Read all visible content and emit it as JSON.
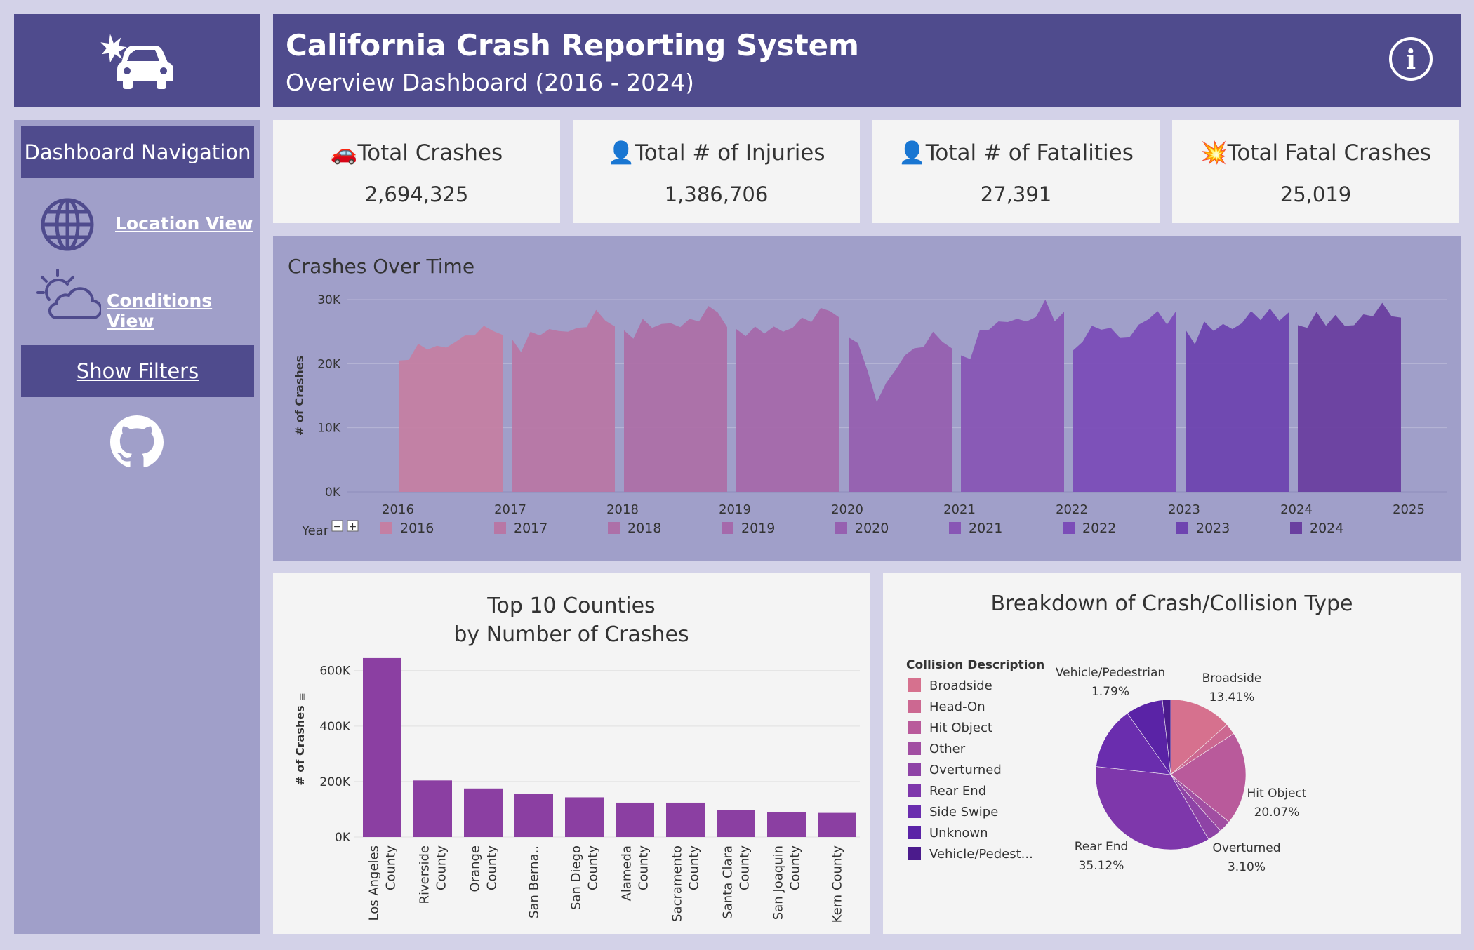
{
  "header": {
    "title": "California Crash Reporting System",
    "subtitle": "Overview Dashboard (2016 - 2024)",
    "info_symbol": "i",
    "logo_icon": "car-crash-icon",
    "accent_color": "#4f4b8d"
  },
  "sidebar": {
    "nav_title": "Dashboard Navigation",
    "links": [
      {
        "label": "Location View",
        "icon": "globe-icon"
      },
      {
        "label": "Conditions View",
        "icon": "weather-icon"
      }
    ],
    "filters_label": "Show Filters",
    "github_icon": "github-icon"
  },
  "kpis": [
    {
      "icon": "🚗",
      "label": "Total Crashes",
      "value": "2,694,325"
    },
    {
      "icon": "👤",
      "label": "Total # of Injuries",
      "value": "1,386,706"
    },
    {
      "icon": "👤",
      "label": "Total # of Fatalities",
      "value": "27,391"
    },
    {
      "icon": "💥",
      "label": "Total Fatal Crashes",
      "value": "25,019"
    }
  ],
  "chart_data": [
    {
      "type": "area",
      "title": "Crashes Over Time",
      "ylabel": "# of Crashes",
      "ylim": [
        0,
        30000
      ],
      "y_ticks": [
        "0K",
        "10K",
        "20K",
        "30K"
      ],
      "x_ticks": [
        "2016",
        "2017",
        "2018",
        "2019",
        "2020",
        "2021",
        "2022",
        "2023",
        "2024",
        "2025"
      ],
      "legend_title": "Year",
      "legend_position": "bottom",
      "grid": true,
      "series": [
        {
          "name": "2016",
          "color": "#c47fa3",
          "values": [
            20500,
            20600,
            23100,
            22200,
            22800,
            22500,
            23400,
            24400,
            24400,
            25900,
            25100,
            24500
          ]
        },
        {
          "name": "2017",
          "color": "#b877a5",
          "values": [
            23900,
            21800,
            25000,
            24400,
            25400,
            25100,
            25000,
            25600,
            25700,
            28400,
            26700,
            25800
          ]
        },
        {
          "name": "2018",
          "color": "#ad70a8",
          "values": [
            25200,
            23900,
            27000,
            25600,
            26200,
            26300,
            25700,
            27000,
            26600,
            29000,
            28000,
            25700
          ]
        },
        {
          "name": "2019",
          "color": "#a569ab",
          "values": [
            25400,
            24300,
            25800,
            24700,
            25800,
            25000,
            25600,
            27200,
            26500,
            28700,
            28200,
            27200
          ]
        },
        {
          "name": "2020",
          "color": "#9660b0",
          "values": [
            24100,
            23200,
            19000,
            14000,
            17000,
            19000,
            21300,
            22400,
            22600,
            25000,
            23400,
            22400
          ]
        },
        {
          "name": "2021",
          "color": "#8856b5",
          "values": [
            21300,
            20700,
            25200,
            25300,
            26600,
            26500,
            27000,
            26600,
            27300,
            30000,
            26600,
            28100
          ]
        },
        {
          "name": "2022",
          "color": "#7b4db8",
          "values": [
            22100,
            23400,
            25900,
            25300,
            25600,
            24000,
            24100,
            26100,
            26900,
            28200,
            26100,
            28300
          ]
        },
        {
          "name": "2023",
          "color": "#6e44b0",
          "values": [
            25300,
            23000,
            26600,
            25100,
            26200,
            25400,
            26300,
            28200,
            26800,
            28600,
            26700,
            28000
          ]
        },
        {
          "name": "2024",
          "color": "#6a3fa0",
          "values": [
            26000,
            25600,
            28100,
            25900,
            27600,
            25900,
            26000,
            27700,
            27400,
            29500,
            27400,
            27200
          ]
        }
      ]
    },
    {
      "type": "bar",
      "title": "Top 10 Counties\nby Number of Crashes",
      "ylabel": "# of Crashes",
      "ylim": [
        0,
        660000
      ],
      "y_ticks": [
        "0K",
        "200K",
        "400K",
        "600K"
      ],
      "color": "#8b3fa2",
      "categories": [
        [
          "Los Angeles",
          "County"
        ],
        [
          "Riverside",
          "County"
        ],
        [
          "Orange",
          "County"
        ],
        [
          "San Berna.."
        ],
        [
          "San Diego",
          "County"
        ],
        [
          "Alameda",
          "County"
        ],
        [
          "Sacramento",
          "County"
        ],
        [
          "Santa Clara",
          "County"
        ],
        [
          "San Joaquin",
          "County"
        ],
        [
          "Kern County"
        ]
      ],
      "values": [
        645000,
        204000,
        175000,
        155000,
        143000,
        124000,
        124000,
        97000,
        89000,
        87000
      ]
    },
    {
      "type": "pie",
      "title": "Breakdown of Crash/Collision Type",
      "legend_title": "Collision Description",
      "legend_position": "left",
      "slices": [
        {
          "label": "Broadside",
          "legend": "Broadside",
          "value": 13.41,
          "pct": "13.41%",
          "color": "#d6718e"
        },
        {
          "label": "Head-On",
          "legend": "Head-On",
          "value": 2.4,
          "pct": "",
          "color": "#cc6891"
        },
        {
          "label": "Hit Object",
          "legend": "Hit Object",
          "value": 20.07,
          "pct": "20.07%",
          "color": "#b95a9b"
        },
        {
          "label": "Other",
          "legend": "Other",
          "value": 2.6,
          "pct": "",
          "color": "#a14ea2"
        },
        {
          "label": "Overturned",
          "legend": "Overturned",
          "value": 3.1,
          "pct": "3.10%",
          "color": "#8e43a6"
        },
        {
          "label": "Rear End",
          "legend": "Rear End",
          "value": 35.12,
          "pct": "35.12%",
          "color": "#7e37ab"
        },
        {
          "label": "Side Swipe",
          "legend": "Side Swipe",
          "value": 13.5,
          "pct": "",
          "color": "#6a2dae"
        },
        {
          "label": "Unknown",
          "legend": "Unknown",
          "value": 8.01,
          "pct": "",
          "color": "#5a23a6"
        },
        {
          "label": "Vehicle/Pedestrian",
          "legend": "Vehicle/Pedest...",
          "value": 1.79,
          "pct": "1.79%",
          "color": "#4b1b8c"
        }
      ]
    }
  ]
}
